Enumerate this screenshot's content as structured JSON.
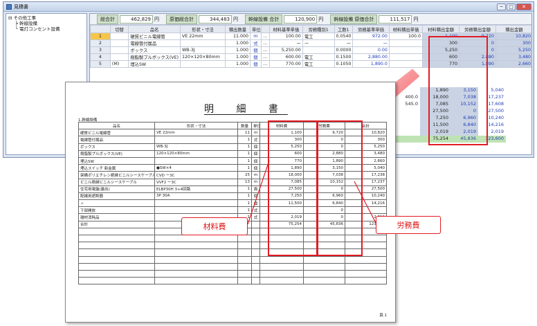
{
  "window": {
    "title": "見積書",
    "controls": [
      "─",
      "□",
      "✕"
    ]
  },
  "tree": {
    "items": [
      "その他工事",
      "幹線設備",
      "電灯コンセント設備"
    ]
  },
  "totals": [
    {
      "label": "総合計",
      "value": "462,829",
      "unit": "円"
    },
    {
      "label": "原価総合計",
      "value": "344,483",
      "unit": "円"
    },
    {
      "label": "幹線設備 合計",
      "value": "120,900",
      "unit": "円"
    },
    {
      "label": "幹線設備 原価合計",
      "value": "111,517",
      "unit": "円"
    }
  ],
  "grid": {
    "headers": [
      "",
      "切替",
      "品名",
      "形状・寸法",
      "積出数量",
      "単位",
      "",
      "材料基準単価",
      "労務種別1",
      "工数1",
      "労務基準単価",
      "材料積出単価",
      "材料積出金額",
      "労務積出金額",
      "積出金額"
    ],
    "rows": [
      {
        "no": "1",
        "sw": "",
        "name": "硬質ビニル電線管",
        "spec": "VE 22mm",
        "qty": "11.000",
        "unit": "m",
        "mat": "100.00",
        "lab": "電工",
        "man": "0.0540",
        "lp": "972.00",
        "mp": "100.0",
        "ma": "1,100",
        "la": "9,720",
        "amt": "10,820"
      },
      {
        "no": "2",
        "sw": "",
        "name": "電線管付属品",
        "spec": "",
        "qty": "1.000",
        "unit": "式",
        "mat": "ー",
        "lab": "ー",
        "man": "ー",
        "lp": "ー",
        "mp": "",
        "ma": "300",
        "la": "0",
        "amt": "300"
      },
      {
        "no": "3",
        "sw": "",
        "name": "ボックス",
        "spec": "WB-3J",
        "qty": "1.000",
        "unit": "個",
        "mat": "5,250.00",
        "lab": "",
        "man": "0.0000",
        "lp": "0.00",
        "mp": "",
        "ma": "5,250",
        "la": "0",
        "amt": "5,250"
      },
      {
        "no": "4",
        "sw": "",
        "name": "樹脂製プルボックス(VE)",
        "spec": "120×120×80mm",
        "qty": "1.000",
        "unit": "個",
        "mat": "600.00",
        "lab": "電工",
        "man": "0.1500",
        "lp": "2,880.00",
        "mp": "",
        "ma": "600",
        "la": "2,880",
        "amt": "3,480"
      },
      {
        "no": "5",
        "sw": "(M)",
        "name": "埋込SW",
        "spec": "",
        "qty": "1.000",
        "unit": "個",
        "mat": "770.00",
        "lab": "電工",
        "man": "0.1050",
        "lp": "1,890.0",
        "mp": "",
        "ma": "770",
        "la": "1,890",
        "amt": "2,660"
      }
    ]
  },
  "extra_rows": [
    [
      "",
      "1,890",
      "3,150",
      "5,040"
    ],
    [
      "400.0",
      "18,000",
      "7,038",
      "17,237"
    ],
    [
      "545.0",
      "7,085",
      "10,152",
      "17,608"
    ],
    [
      "",
      "27,500",
      "0",
      "27,500"
    ],
    [
      "",
      "7,250",
      "6,960",
      "10,240"
    ],
    [
      "",
      "11,500",
      "6,840",
      "14,216"
    ],
    [
      "",
      "2,019",
      "2,019",
      "2,019"
    ],
    [
      "",
      "75,254",
      "45,836",
      "123,600"
    ]
  ],
  "doc": {
    "title": "明 細 書",
    "section": "1.幹線設備",
    "headers": [
      "品名",
      "形状・寸法",
      "数量",
      "単位",
      "材料費",
      "労務費",
      "合計"
    ],
    "rows": [
      [
        "硬質ビニル電線管",
        "VE 22mm",
        "11",
        "m",
        "1,100",
        "9,720",
        "10,820"
      ],
      [
        "電線管付属品",
        "",
        "1",
        "式",
        "300",
        "0",
        "300"
      ],
      [
        "ボックス",
        "WB-3J",
        "1",
        "個",
        "5,250",
        "0",
        "5,250"
      ],
      [
        "樹脂製プルボックス(VE)",
        "120×120×80mm",
        "1",
        "個",
        "600",
        "2,880",
        "3,480"
      ],
      [
        "埋込SW",
        "",
        "1",
        "個",
        "770",
        "1,890",
        "2,660"
      ],
      [
        "埋込スイッチ 新金属",
        "●SW×4",
        "1",
        "個",
        "1,890",
        "3,150",
        "5,040"
      ],
      [
        "架橋ポリエチレン絶縁ビニルシースケーブル",
        "CVD ー3C",
        "25",
        "m",
        "18,000",
        "7,038",
        "17,238"
      ],
      [
        "ビニル絶縁ビニルシースケーブル",
        "VVF2 ー3C",
        "13",
        "m",
        "7,085",
        "10,152",
        "17,237"
      ],
      [
        "住宅用電盤(露出)",
        "ELBP30H 3+4回路",
        "1",
        "面",
        "27,500",
        "0",
        "27,500"
      ],
      [
        "配線用遮断器",
        "3P 30A",
        "1",
        "個",
        "7,250",
        "6,960",
        "10,240"
      ],
      [
        "〃",
        "",
        "1",
        "個",
        "11,500",
        "6,840",
        "14,216"
      ],
      [
        "下部開放",
        "",
        "1",
        "式",
        "",
        "0",
        ""
      ],
      [
        "雑材消耗品",
        "",
        "1",
        "式",
        "2,019",
        "0",
        "2,019"
      ],
      [
        "合計",
        "",
        "",
        "",
        "75,254",
        "45,836",
        "123,600"
      ]
    ],
    "page": "頁.1"
  },
  "labels": {
    "material": "材料費",
    "labor": "労務費"
  }
}
